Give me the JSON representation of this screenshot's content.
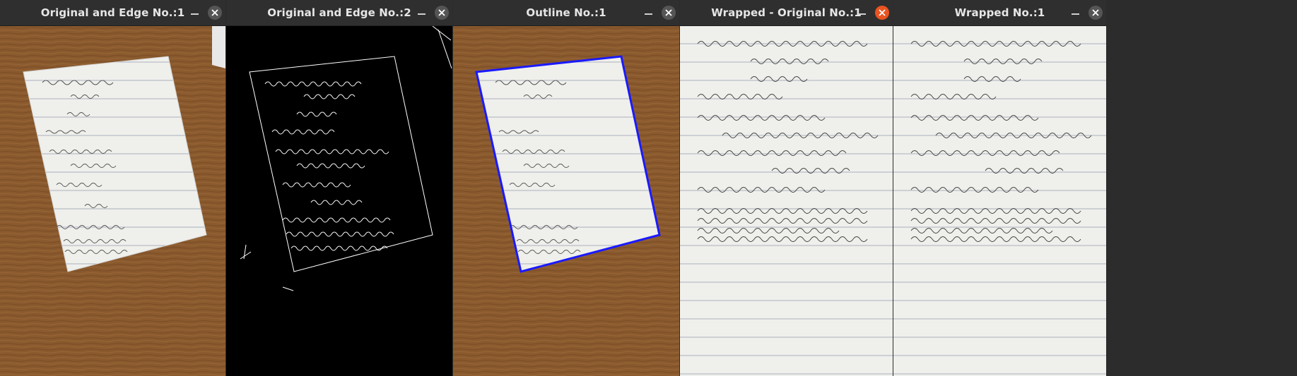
{
  "windows": [
    {
      "title": "Original and Edge No.:1",
      "view": "photo-table-icon"
    },
    {
      "title": "Original and Edge No.:2",
      "view": "edge-map-icon"
    },
    {
      "title": "Outline No.:1",
      "view": "photo-outline-icon"
    },
    {
      "title": "Wrapped - Original No.:1",
      "view": "warped-page-icon",
      "active": true
    },
    {
      "title": "Wrapped No.:1",
      "view": "warped-page-icon"
    }
  ],
  "colors": {
    "titlebar": "#2f2f2f",
    "close_active": "#e95420",
    "outline": "#1a1aff",
    "wood": "#8a5a2e",
    "paper": "#efefec"
  },
  "icons": {
    "minimize": "minimize-icon",
    "close": "close-icon"
  }
}
